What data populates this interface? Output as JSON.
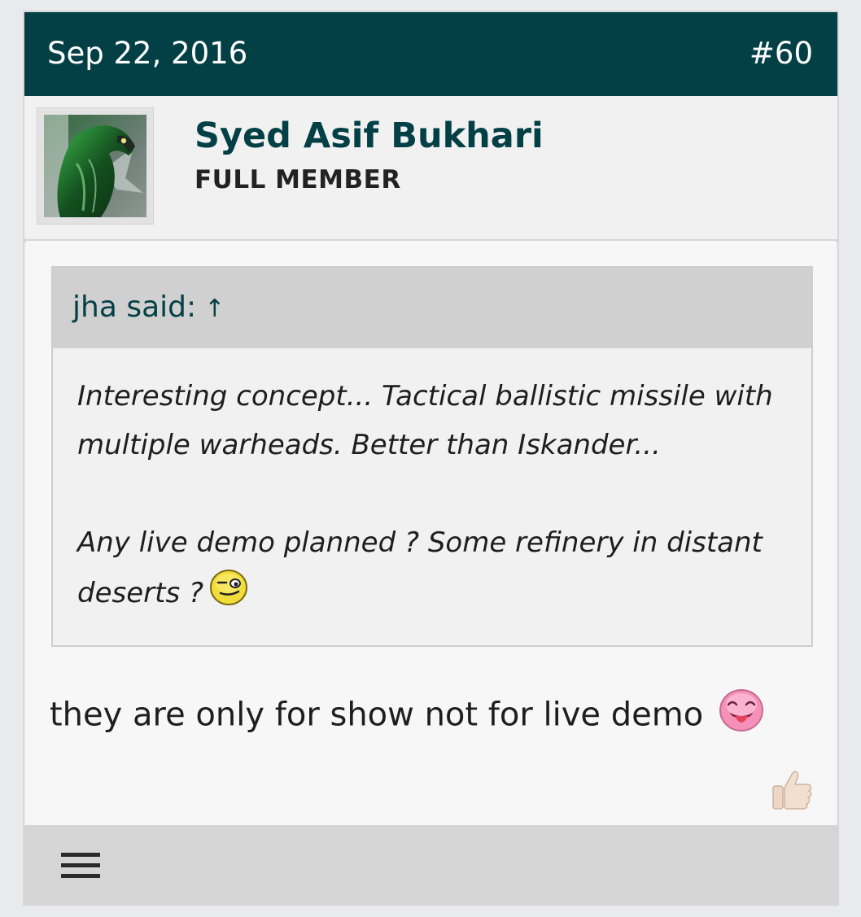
{
  "post": {
    "date": "Sep 22, 2016",
    "number": "#60"
  },
  "user": {
    "name": "Syed Asif Bukhari",
    "title": "FULL MEMBER",
    "avatar_icon": "falcon-flag-avatar"
  },
  "quote": {
    "attribution": "jha said:",
    "jump_icon": "↑",
    "paragraph1": "Interesting concept... Tactical ballistic missile with multiple warheads. Better than Iskander...",
    "paragraph2": "Any live demo planned ? Some refinery in distant deserts ?",
    "smiley_icon": "wink-smiley"
  },
  "reply": {
    "text": "they are only for show not for live demo",
    "smiley_icon": "tongue-out-smiley"
  },
  "actions": {
    "like_icon": "thumbs-up-icon",
    "menu_icon": "hamburger-menu-icon"
  },
  "colors": {
    "header_bg": "#034046",
    "accent": "#034046",
    "page_bg": "#e9eaed"
  }
}
